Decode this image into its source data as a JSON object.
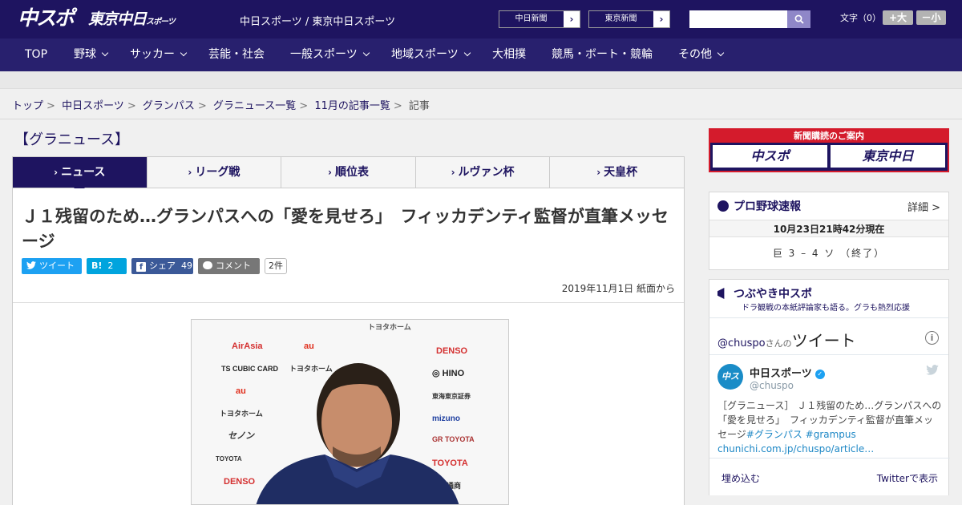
{
  "header": {
    "logo_chuspo": "中スポ",
    "logo_tokyo": "東京中日",
    "logo_tokyo_small": "スポーツ",
    "site_title": "中日スポーツ / 東京中日スポーツ",
    "chunichi_button": "中日新聞",
    "tokyo_button": "東京新聞",
    "search_placeholder": "",
    "font_label": "文字（0）",
    "font_larger": "+大",
    "font_smaller": "－小"
  },
  "nav": {
    "items": [
      {
        "label": "TOP"
      },
      {
        "label": "野球"
      },
      {
        "label": "サッカー"
      },
      {
        "label": "芸能・社会"
      },
      {
        "label": "一般スポーツ"
      },
      {
        "label": "地域スポーツ"
      },
      {
        "label": "大相撲"
      },
      {
        "label": "競馬・ボート・競輪"
      },
      {
        "label": "その他"
      }
    ]
  },
  "breadcrumb": {
    "items": [
      "トップ",
      "中日スポーツ",
      "グランパス",
      "グラニュース一覧",
      "11月の記事一覧"
    ],
    "current": "記事",
    "separator": ">"
  },
  "section_title": "【グラニュース】",
  "tabs": [
    {
      "label": "ニュース",
      "active": true
    },
    {
      "label": "リーグ戦"
    },
    {
      "label": "順位表"
    },
    {
      "label": "ルヴァン杯"
    },
    {
      "label": "天皇杯"
    }
  ],
  "article": {
    "headline": "Ｊ１残留のため…グランパスへの「愛を見せろ」　フィッカデンティ監督が直筆メッセージ",
    "tweet_label": "ツイート",
    "hatena_label": "B!",
    "hatena_count": "2",
    "share_label": "シェア",
    "share_count": "49",
    "comment_label": "コメント",
    "comment_count": "2件",
    "dateline": "2019年11月1日 紙面から"
  },
  "sidebar": {
    "ad_title": "新聞購読のご案内",
    "ad_logo1": "中スポ",
    "ad_logo2": "東京中日",
    "baseball": {
      "title": "プロ野球速報",
      "detail": "詳細 >",
      "date": "10月23日21時42分現在",
      "score": "巨 3 – 4 ソ （終了）"
    },
    "tsubuyaki": {
      "title": "つぶやき中スポ",
      "subtitle": "ドラ観戦の本紙評論家も語る。グラも熱烈応援"
    },
    "twitter": {
      "handle": "@chuspo",
      "handle_suffix": "さんの",
      "heading": "ツイート",
      "avatar_text": "中スポ",
      "name": "中日スポーツ",
      "username": "@chuspo",
      "tweet_prefix": "［グラニュース］ Ｊ１残留のため…グランパスへの「愛を見せろ」　フィッカデンティ監督が直筆メッセージ",
      "hashtag1": "#グランパス",
      "hashtag2": "#grampus",
      "link": "chunichi.com.jp/chuspo/article…",
      "embed": "埋め込む",
      "view": "Twitterで表示"
    }
  },
  "colors": {
    "brand": "#1e1460",
    "accent_red": "#d41b2c",
    "twitter_blue": "#1da1f2",
    "hatena": "#00a4de",
    "facebook": "#3b5998"
  }
}
